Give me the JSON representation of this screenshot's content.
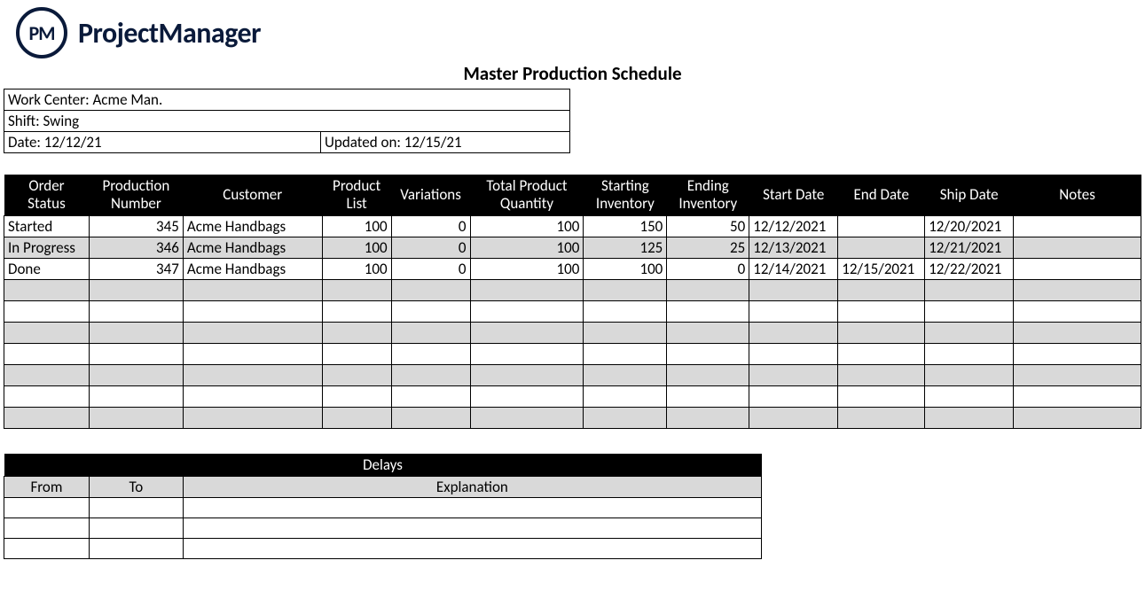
{
  "logo": {
    "badge": "PM",
    "text": "ProjectManager"
  },
  "title": "Master Production Schedule",
  "info": {
    "work_center": "Work Center: Acme Man.",
    "shift": "Shift: Swing",
    "date": "Date: 12/12/21",
    "updated": "Updated on: 12/15/21"
  },
  "headers": {
    "status": "Order\nStatus",
    "prodnum": "Production\nNumber",
    "customer": "Customer",
    "plist": "Product\nList",
    "var": "Variations",
    "tpq": "Total Product\nQuantity",
    "sinv": "Starting\nInventory",
    "einv": "Ending\nInventory",
    "sdate": "Start Date",
    "edate": "End Date",
    "ship": "Ship Date",
    "notes": "Notes"
  },
  "rows": [
    {
      "status": "Started",
      "prodnum": "345",
      "customer": "Acme Handbags",
      "plist": "100",
      "var": "0",
      "tpq": "100",
      "sinv": "150",
      "einv": "50",
      "sdate": "12/12/2021",
      "edate": "",
      "ship": "12/20/2021",
      "notes": ""
    },
    {
      "status": "In Progress",
      "prodnum": "346",
      "customer": "Acme Handbags",
      "plist": "100",
      "var": "0",
      "tpq": "100",
      "sinv": "125",
      "einv": "25",
      "sdate": "12/13/2021",
      "edate": "",
      "ship": "12/21/2021",
      "notes": ""
    },
    {
      "status": "Done",
      "prodnum": "347",
      "customer": "Acme Handbags",
      "plist": "100",
      "var": "0",
      "tpq": "100",
      "sinv": "100",
      "einv": "0",
      "sdate": "12/14/2021",
      "edate": "12/15/2021",
      "ship": "12/22/2021",
      "notes": ""
    },
    {},
    {},
    {},
    {},
    {},
    {},
    {}
  ],
  "delays": {
    "title": "Delays",
    "from": "From",
    "to": "To",
    "explanation": "Explanation",
    "rows": [
      {},
      {},
      {}
    ]
  }
}
